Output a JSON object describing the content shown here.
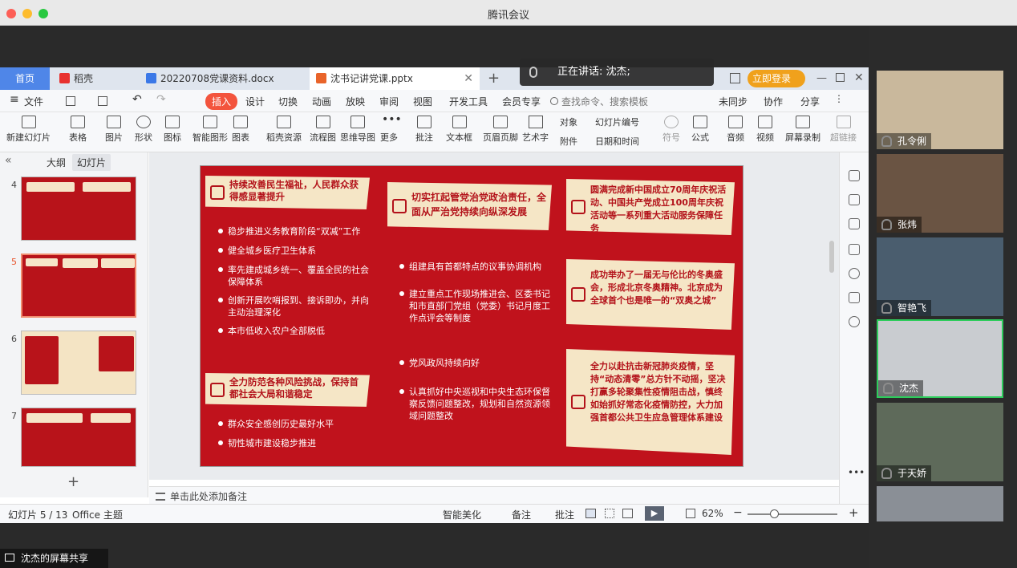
{
  "window": {
    "title": "腾讯会议"
  },
  "speaking": {
    "text": "正在讲话: 沈杰;"
  },
  "tabs": {
    "home": "首页",
    "daoke": "稻壳",
    "docx": "20220708党课资料.docx",
    "pptx": "沈书记讲党课.pptx",
    "add": "+",
    "login": "立即登录"
  },
  "menu": {
    "file": "文件",
    "items": [
      "插入",
      "设计",
      "切换",
      "动画",
      "放映",
      "审阅",
      "视图",
      "开发工具",
      "会员专享"
    ],
    "search_placeholder": "查找命令、搜索模板",
    "sync": "未同步",
    "collab": "协作",
    "share": "分享"
  },
  "ribbon": [
    "新建幻灯片",
    "表格",
    "图片",
    "形状",
    "图标",
    "智能图形",
    "图表",
    "稻壳资源",
    "流程图",
    "思维导图",
    "更多",
    "批注",
    "文本框",
    "页眉页脚",
    "艺术字",
    "符号",
    "公式",
    "音频",
    "视频",
    "屏幕录制",
    "超链接"
  ],
  "ribbon_small": {
    "object": "对象",
    "slide_num": "幻灯片编号",
    "attach": "附件",
    "datetime": "日期和时间"
  },
  "panel": {
    "outline": "大纲",
    "slides": "幻灯片",
    "numbers": [
      "4",
      "5",
      "6",
      "7"
    ],
    "add": "+"
  },
  "slide": {
    "c1_head": "持续改善民生福祉，人民群众获得感显著提升",
    "c1_items": [
      "稳步推进义务教育阶段“双减”工作",
      "健全城乡医疗卫生体系",
      "率先建成城乡统一、覆盖全民的社会保障体系",
      "创新开展吹哨报到、接诉即办，并向主动治理深化",
      "本市低收入农户全部脱低"
    ],
    "c2_head": "全力防范各种风险挑战，保持首都社会大局和谐稳定",
    "c2_items": [
      "群众安全感创历史最好水平",
      "韧性城市建设稳步推进"
    ],
    "c3_head": "切实扛起管党治党政治责任，全面从严治党持续向纵深发展",
    "c3_items": [
      "组建具有首都特点的议事协调机构",
      "建立重点工作现场推进会、区委书记和市直部门党组（党委）书记月度工作点评会等制度",
      "党风政风持续向好",
      "认真抓好中央巡视和中央生态环保督察反馈问题整改，规划和自然资源领域问题整改"
    ],
    "c4_head": "圆满完成新中国成立70周年庆祝活动、中国共产党成立100周年庆祝活动等一系列重大活动服务保障任务",
    "c5_head": "成功举办了一届无与伦比的冬奥盛会，形成北京冬奥精神。北京成为全球首个也是唯一的“双奥之城”",
    "c6_head": "全力以赴抗击新冠肺炎疫情，坚持“动态清零”总方针不动摇，坚决打赢多轮聚集性疫情阻击战，慎终如始抓好常态化疫情防控，大力加强首都公共卫生应急管理体系建设"
  },
  "notes": {
    "placeholder": "单击此处添加备注"
  },
  "status": {
    "slide": "幻灯片 5 / 13",
    "theme": "Office 主题",
    "beautify": "智能美化",
    "notes": "备注",
    "comment": "批注",
    "zoom": "62%"
  },
  "participants": [
    "孔令俐",
    "张炜",
    "智艳飞",
    "沈杰",
    "于天娇"
  ],
  "share": {
    "label": "沈杰的屏幕共享"
  }
}
